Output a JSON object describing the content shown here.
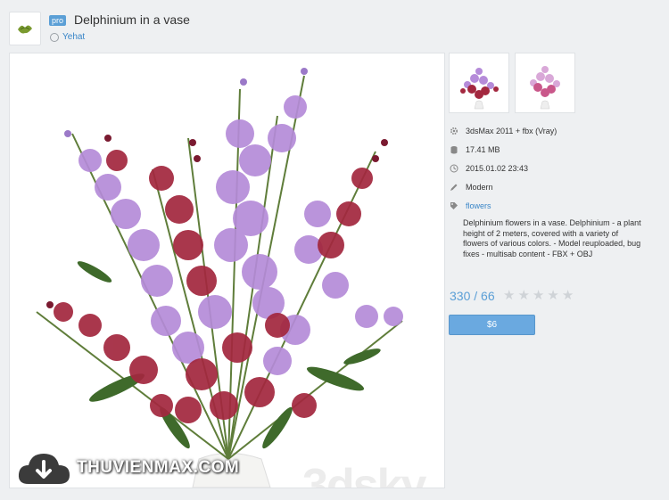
{
  "header": {
    "badge": "pro",
    "title": "Delphinium in a vase",
    "author": "Yehat"
  },
  "details": {
    "software": "3dsMax 2011 + fbx (Vray)",
    "size": "17.41 MB",
    "date": "2015.01.02 23:43",
    "style": "Modern",
    "tag": "flowers",
    "description": "Delphinium flowers in a vase. Delphinium - a plant height of 2 meters, covered with a variety of flowers of various colors. - Model reuploaded, bug fixes - multisab content - FBX + OBJ"
  },
  "rating": {
    "text": "330 / 66",
    "stars_filled": 0,
    "stars_total": 5
  },
  "price_button": {
    "label": "$6"
  },
  "watermarks": {
    "main_image": "3dsky",
    "site": "THUVIENMAX.COM"
  },
  "colors": {
    "link": "#3a86c8",
    "accent": "#6aa9e0",
    "purple_flower": "#b58bd9",
    "red_flower": "#a3283f"
  }
}
